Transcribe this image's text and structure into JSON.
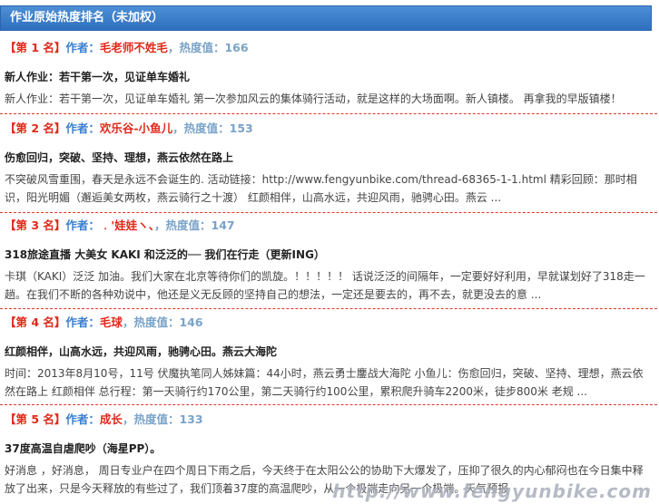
{
  "header": {
    "title": "作业原始热度排名（未加权）"
  },
  "labels": {
    "author_prefix": "作者：",
    "heat_prefix": "热度值："
  },
  "entries": [
    {
      "rank": "【第 1 名】",
      "author": "毛老师不姓毛",
      "sep": "，",
      "heat": "166",
      "title": "新人作业：若干第一次，见证单车婚礼",
      "excerpt": "新人作业：若干第一次，见证单车婚礼 第一次参加风云的集体骑行活动，就是这样的大场面啊。新人镇楼。 再拿我的早版镇楼！"
    },
    {
      "rank": "【第 2 名】",
      "author": "欢乐谷-小鱼儿",
      "sep": "，",
      "heat": "153",
      "title": "伤愈回归，突破、坚持、理想，燕云依然在路上",
      "excerpt": "不突破风雪重围，春天是永远不会诞生的. 活动链接：http://www.fengyunbike.com/thread-68365-1-1.html 精彩回顾：那时相识，阳光明媚（邂逅美女两枚，燕云骑行之十渡） 红颜相伴，山高水远，共迎风雨，驰骋心田。燕云 ..."
    },
    {
      "rank": "【第 3 名】",
      "author": "﹒'娃娃ヽ、",
      "sep": "，",
      "heat": "147",
      "title": "318旅途直播 大美女 KAKI 和泛泛的── 我们在行走（更新ING）",
      "excerpt": "卡琪（KAKI）泛泛 加油。我们大家在北京等待你们的凯旋。！！！！！ 话说泛泛的间隔年，一定要好好利用，早就谋划好了318走一趟。在我们不断的各种劝说中，他还是义无反顾的坚持自己的想法，一定还是要去的，再不去，就更没去的意 ..."
    },
    {
      "rank": "【第 4 名】",
      "author": "毛球",
      "sep": "，",
      "heat": "146",
      "title": "红颜相伴，山高水远，共迎风雨，驰骋心田。燕云大海陀",
      "excerpt": "时间：2013年8月10号，11号 伏魔执笔同人姊妹篇：44小时，燕云勇士鏖战大海陀 小鱼儿：伤愈回归，突破、坚持、理想，燕云依然在路上 红颜相伴 总行程：第一天骑行约170公里，第二天骑行约100公里，累积爬升骑车2200米，徒步800米 老规 ..."
    },
    {
      "rank": "【第 5 名】",
      "author": "成长",
      "sep": "，",
      "heat": "133",
      "title": "37度高温自虐爬吵（海星PP）。",
      "excerpt": "好消息 ，好消息， 周日专业户在四个周日下雨之后，今天终于在太阳公公的协助下大爆发了，压抑了很久的内心郁闷也在今日集中释放了出来，只是今天释放的有些过了，我们顶着37度的高温爬吵，从一个极端走向另一个极端。天气预报"
    }
  ],
  "watermark": "http://www.fengyunbike.com"
}
